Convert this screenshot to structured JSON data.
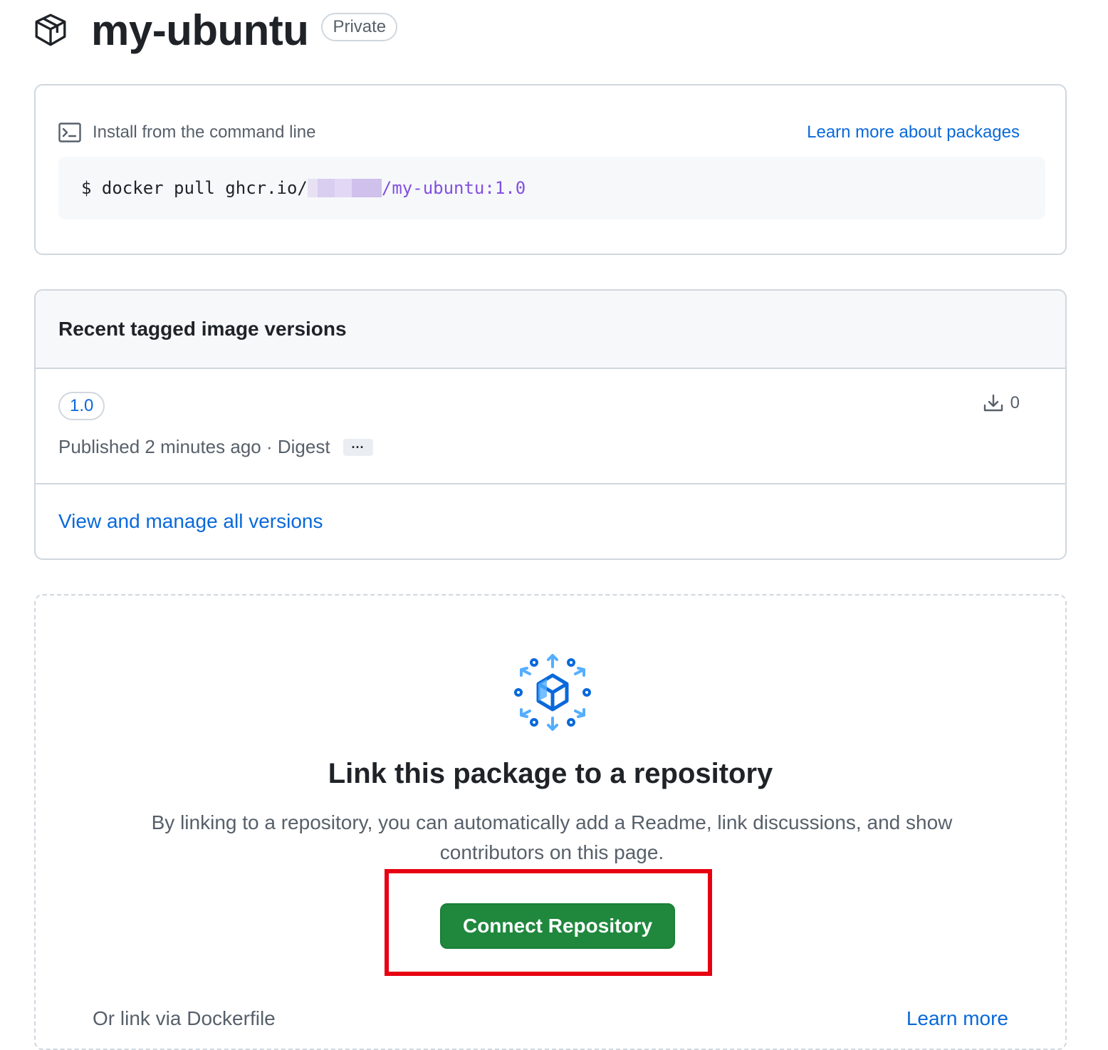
{
  "header": {
    "icon": "package-icon",
    "title": "my-ubuntu",
    "visibility_badge": "Private"
  },
  "install": {
    "icon": "terminal-icon",
    "heading": "Install from the command line",
    "learn_link": "Learn more about packages",
    "command_prefix": "$ docker pull ghcr.io/",
    "command_path": "/my-ubuntu:1.0"
  },
  "versions": {
    "heading": "Recent tagged image versions",
    "items": [
      {
        "tag": "1.0",
        "downloads": "0",
        "published": "Published 2 minutes ago · Digest",
        "digest_button": "···"
      }
    ],
    "view_all": "View and manage all versions"
  },
  "link_repo": {
    "icon": "package-link-icon",
    "title": "Link this package to a repository",
    "description": "By linking to a repository, you can automatically add a Readme, link discussions, and show contributors on this page.",
    "connect_button": "Connect Repository",
    "dockerfile_text": "Or link via Dockerfile",
    "learn_more": "Learn more"
  },
  "colors": {
    "link": "#0969da",
    "button_green": "#1f883d",
    "highlight_red": "#e60012",
    "code_purple": "#8250df"
  }
}
